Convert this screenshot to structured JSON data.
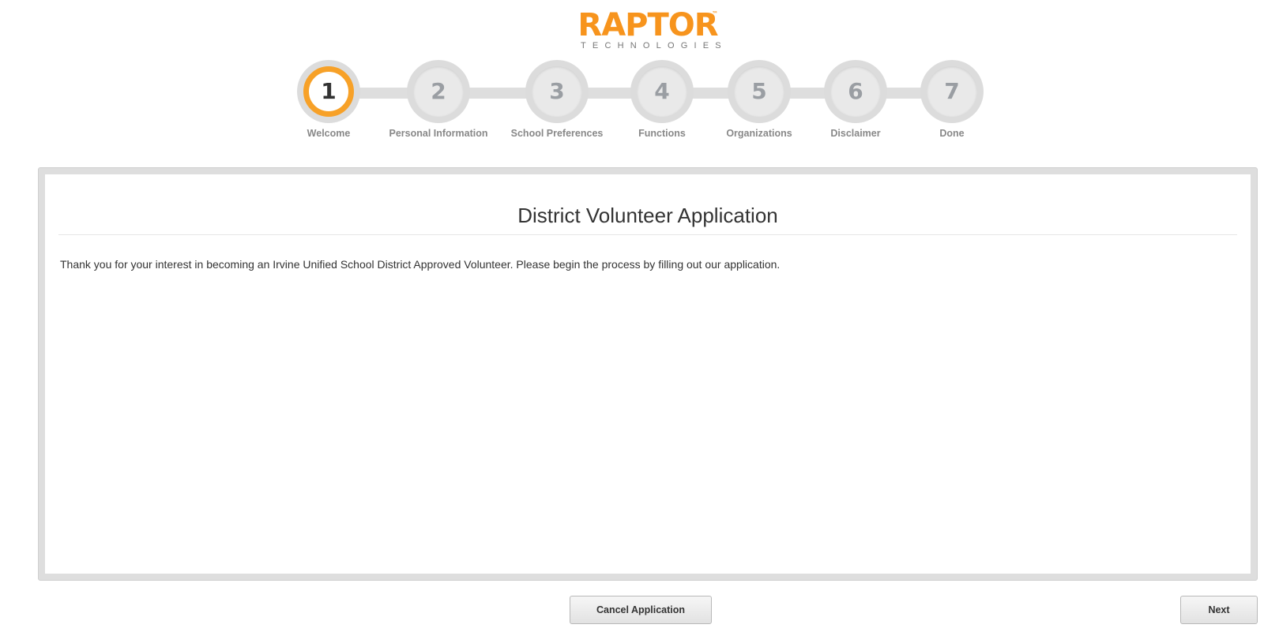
{
  "logo": {
    "word": "RAPTOR",
    "tm": "™",
    "sub": "TECHNOLOGIES",
    "brand_color": "#f7941d"
  },
  "steps": [
    {
      "number": "1",
      "label": "Welcome",
      "active": true
    },
    {
      "number": "2",
      "label": "Personal Information",
      "active": false
    },
    {
      "number": "3",
      "label": "School Preferences",
      "active": false
    },
    {
      "number": "4",
      "label": "Functions",
      "active": false
    },
    {
      "number": "5",
      "label": "Organizations",
      "active": false
    },
    {
      "number": "6",
      "label": "Disclaimer",
      "active": false
    },
    {
      "number": "7",
      "label": "Done",
      "active": false
    }
  ],
  "panel": {
    "title": "District Volunteer Application",
    "text": "Thank you for your interest in becoming an Irvine Unified School District Approved Volunteer. Please begin the process by filling out our application."
  },
  "buttons": {
    "cancel": "Cancel Application",
    "next": "Next"
  },
  "colors": {
    "accent": "#f7a128",
    "step_inactive": "#e9e9e9",
    "track": "#dedede"
  }
}
